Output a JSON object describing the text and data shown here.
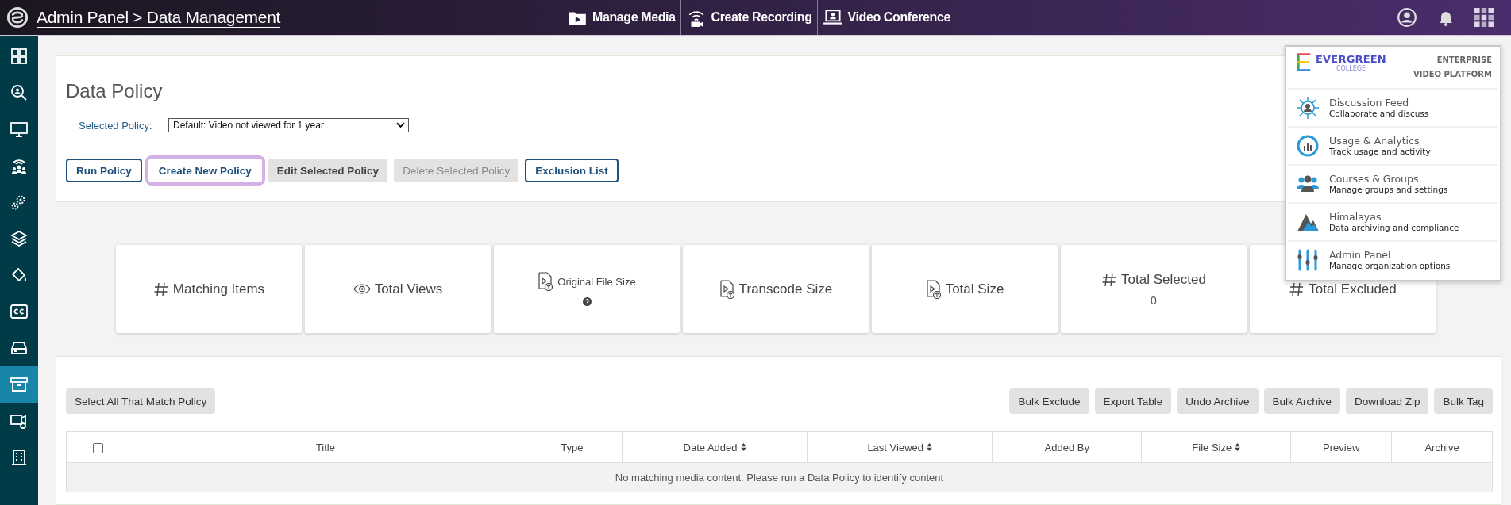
{
  "header": {
    "breadcrumb": "Admin Panel > Data Management",
    "nav": [
      {
        "label": "Manage Media"
      },
      {
        "label": "Create Recording"
      },
      {
        "label": "Video Conference"
      }
    ]
  },
  "sidebar": {
    "items": [
      {
        "selected": false
      },
      {
        "selected": false
      },
      {
        "selected": false
      },
      {
        "selected": false
      },
      {
        "selected": false
      },
      {
        "selected": false
      },
      {
        "selected": false
      },
      {
        "selected": false
      },
      {
        "selected": false
      },
      {
        "selected": true
      },
      {
        "selected": false
      },
      {
        "selected": false
      }
    ]
  },
  "policy": {
    "title": "Data Policy",
    "label": "Selected Policy:",
    "value": "Default: Video not viewed for 1 year",
    "buttons": [
      {
        "label": "Run Policy",
        "kind": "outline",
        "disabled": false,
        "focused": false
      },
      {
        "label": "Create New Policy",
        "kind": "outline",
        "disabled": false,
        "focused": true
      },
      {
        "label": "Edit Selected Policy",
        "kind": "grey",
        "disabled": false,
        "focused": false
      },
      {
        "label": "Delete Selected Policy",
        "kind": "grey",
        "disabled": true,
        "focused": false
      },
      {
        "label": "Exclusion List",
        "kind": "outline",
        "disabled": false,
        "focused": false
      }
    ]
  },
  "stats": [
    {
      "label": "Matching Items",
      "kind": "count"
    },
    {
      "label": "Total Views",
      "kind": "views"
    },
    {
      "label": "Original File Size",
      "kind": "file",
      "help": true
    },
    {
      "label": "Transcode Size",
      "kind": "file"
    },
    {
      "label": "Total Size",
      "kind": "file"
    },
    {
      "label": "Total Selected",
      "kind": "count",
      "value": "0"
    },
    {
      "label": "Total Excluded",
      "kind": "count"
    }
  ],
  "table": {
    "select_all": "Select All That Match Policy",
    "actions": [
      "Bulk Exclude",
      "Export Table",
      "Undo Archive",
      "Bulk Archive",
      "Download Zip",
      "Bulk Tag"
    ],
    "columns": [
      {
        "kind": "checkbox",
        "checked": false
      },
      {
        "kind": "text",
        "label": "Title",
        "sortable": false
      },
      {
        "kind": "text",
        "label": "Type",
        "sortable": false
      },
      {
        "kind": "text",
        "label": "Date Added",
        "sortable": true
      },
      {
        "kind": "text",
        "label": "Last Viewed",
        "sortable": true
      },
      {
        "kind": "text",
        "label": "Added By",
        "sortable": false
      },
      {
        "kind": "text",
        "label": "File Size",
        "sortable": true
      },
      {
        "kind": "text",
        "label": "Preview",
        "sortable": false
      },
      {
        "kind": "text",
        "label": "Archive",
        "sortable": false
      }
    ],
    "empty_message": "No matching media content. Please run a Data Policy to identify content"
  },
  "apps_menu": {
    "brand": "EVERGREEN",
    "brand_sub": "COLLEGE",
    "tagline": "ENTERPRISE VIDEO PLATFORM",
    "items": [
      {
        "title": "Discussion Feed",
        "subtitle": "Collaborate and discuss"
      },
      {
        "title": "Usage & Analytics",
        "subtitle": "Track usage and activity"
      },
      {
        "title": "Courses & Groups",
        "subtitle": "Manage groups and settings"
      },
      {
        "title": "Himalayas",
        "subtitle": "Data archiving and compliance"
      },
      {
        "title": "Admin Panel",
        "subtitle": "Manage organization options"
      }
    ]
  }
}
